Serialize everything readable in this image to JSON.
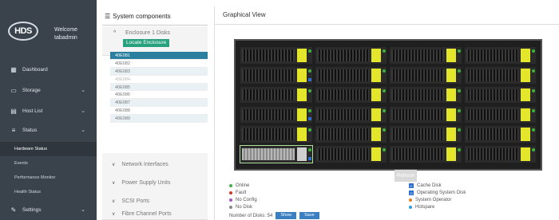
{
  "sidebar": {
    "logo": "HDS",
    "welcome_line1": "Welcome",
    "welcome_line2": "tabadmin",
    "items": [
      {
        "label": "Dashboard",
        "icon": "dashboard-icon",
        "glyph": "▦"
      },
      {
        "label": "Storage",
        "icon": "storage-icon",
        "glyph": "▭"
      },
      {
        "label": "Host List",
        "icon": "host-list-icon",
        "glyph": "▤"
      },
      {
        "label": "Status",
        "icon": "status-icon",
        "glyph": "≡"
      },
      {
        "label": "Settings",
        "icon": "settings-icon",
        "glyph": "✎"
      }
    ],
    "subitems": [
      "Hardware Status",
      "Events",
      "Performance Monitor",
      "Health Status"
    ],
    "active_subitem": "Hardware Status"
  },
  "components": {
    "title": "System components",
    "enclosure": {
      "label": "Enclosure 1 Disks",
      "locate_button": "Locate Enclosure"
    },
    "slots": [
      "40E081",
      "40E082",
      "40E083",
      "40E084",
      "40E085",
      "40E086",
      "40E087",
      "40E088",
      "40E089"
    ],
    "sections": [
      "Network Interfaces",
      "Power Supply Units",
      "SCSI Ports",
      "Fibre Channel Ports"
    ]
  },
  "graphical": {
    "title": "Graphical View",
    "refresh_button": "Refresh",
    "legend_left": [
      {
        "label": "Online",
        "color": "#3bb33b"
      },
      {
        "label": "Fault",
        "color": "#d9342b"
      },
      {
        "label": "No Config",
        "color": "#a855c9"
      },
      {
        "label": "No Disk",
        "color": "#888888"
      }
    ],
    "legend_right": [
      {
        "label": "Cache Disk",
        "color": "#2e6ed1",
        "mark": "C"
      },
      {
        "label": "Operating System Disk",
        "color": "#2e6ed1",
        "mark": "O"
      },
      {
        "label": "System Operator",
        "color": "#e67e22",
        "mark": ""
      },
      {
        "label": "Hotspare",
        "color": "#2e9be6",
        "mark": ""
      }
    ],
    "disk_count_label": "Number of Disks: 54",
    "button_a": "Show",
    "button_b": "Save"
  }
}
